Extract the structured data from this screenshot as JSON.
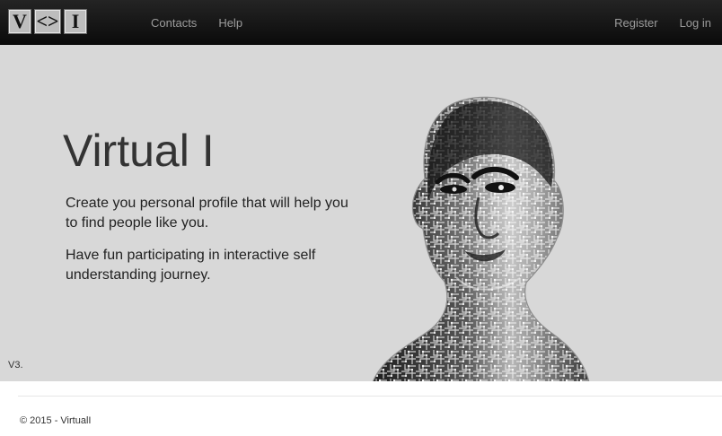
{
  "navbar": {
    "logo": {
      "letters": [
        "V",
        "<>",
        "I"
      ]
    },
    "links": [
      {
        "label": "Contacts"
      },
      {
        "label": "Help"
      }
    ],
    "right_links": [
      {
        "label": "Register"
      },
      {
        "label": "Log in"
      }
    ]
  },
  "hero": {
    "title": "Virtual I",
    "paragraph_1": "Create you personal profile that will help you to find people like you.",
    "paragraph_2": "Have fun participating in interactive self understanding journey.",
    "image_icon": "circuit-face-portrait-icon"
  },
  "version": "V3.",
  "footer": {
    "copyright": "© 2015 - VirtualI"
  },
  "colors": {
    "navbar": "#111111",
    "hero_background": "#d8d8d8",
    "nav_text": "#9c9c9c",
    "title_text": "#333333"
  }
}
